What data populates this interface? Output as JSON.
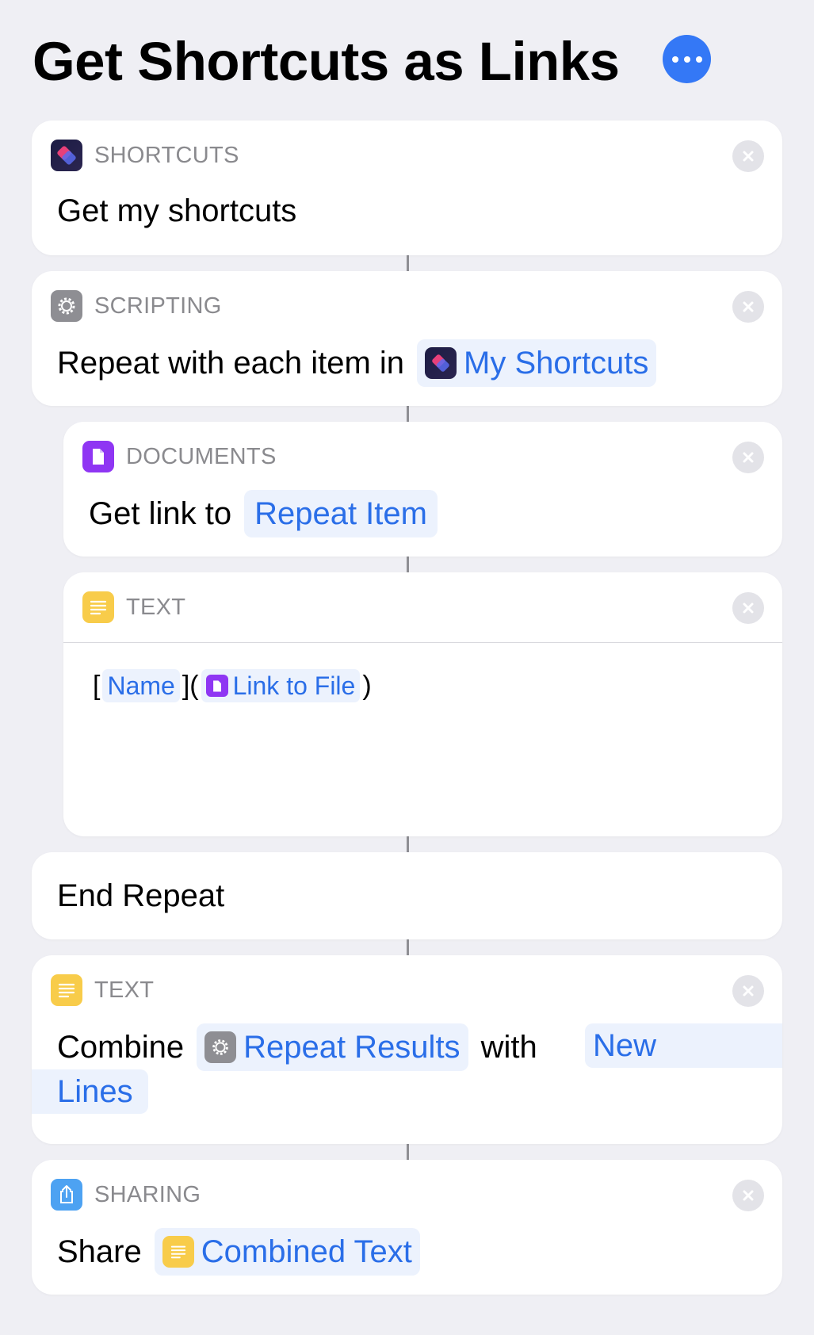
{
  "header": {
    "title": "Get Shortcuts as Links",
    "more_icon": "ellipsis-icon",
    "accent": "#3478f6"
  },
  "actions": [
    {
      "category": "SHORTCUTS",
      "icon": "shortcuts-app-icon",
      "text": "Get my shortcuts"
    },
    {
      "category": "SCRIPTING",
      "icon": "gear-icon",
      "text": "Repeat with each item in",
      "token": "My Shortcuts"
    },
    {
      "category": "DOCUMENTS",
      "icon": "document-icon",
      "text": "Get link to",
      "token": "Repeat Item"
    },
    {
      "category": "TEXT",
      "icon": "text-icon",
      "open_bracket": "[",
      "token_name": "Name",
      "mid": "](",
      "token_link": "Link to File",
      "close": ")"
    },
    {
      "text": "End Repeat"
    },
    {
      "category": "TEXT",
      "icon": "text-icon",
      "text": "Combine",
      "token": "Repeat Results",
      "mid": "with",
      "token2_line1": "New",
      "token2_line2": "Lines"
    },
    {
      "category": "SHARING",
      "icon": "share-icon",
      "text": "Share",
      "token": "Combined Text"
    }
  ],
  "colors": {
    "variable_text": "#2a6ee8",
    "variable_bg": "#ecf2fd",
    "documents": "#8f36f3",
    "text": "#f8cc4a",
    "sharing": "#4da2f2",
    "scripting": "#8e8e93"
  }
}
